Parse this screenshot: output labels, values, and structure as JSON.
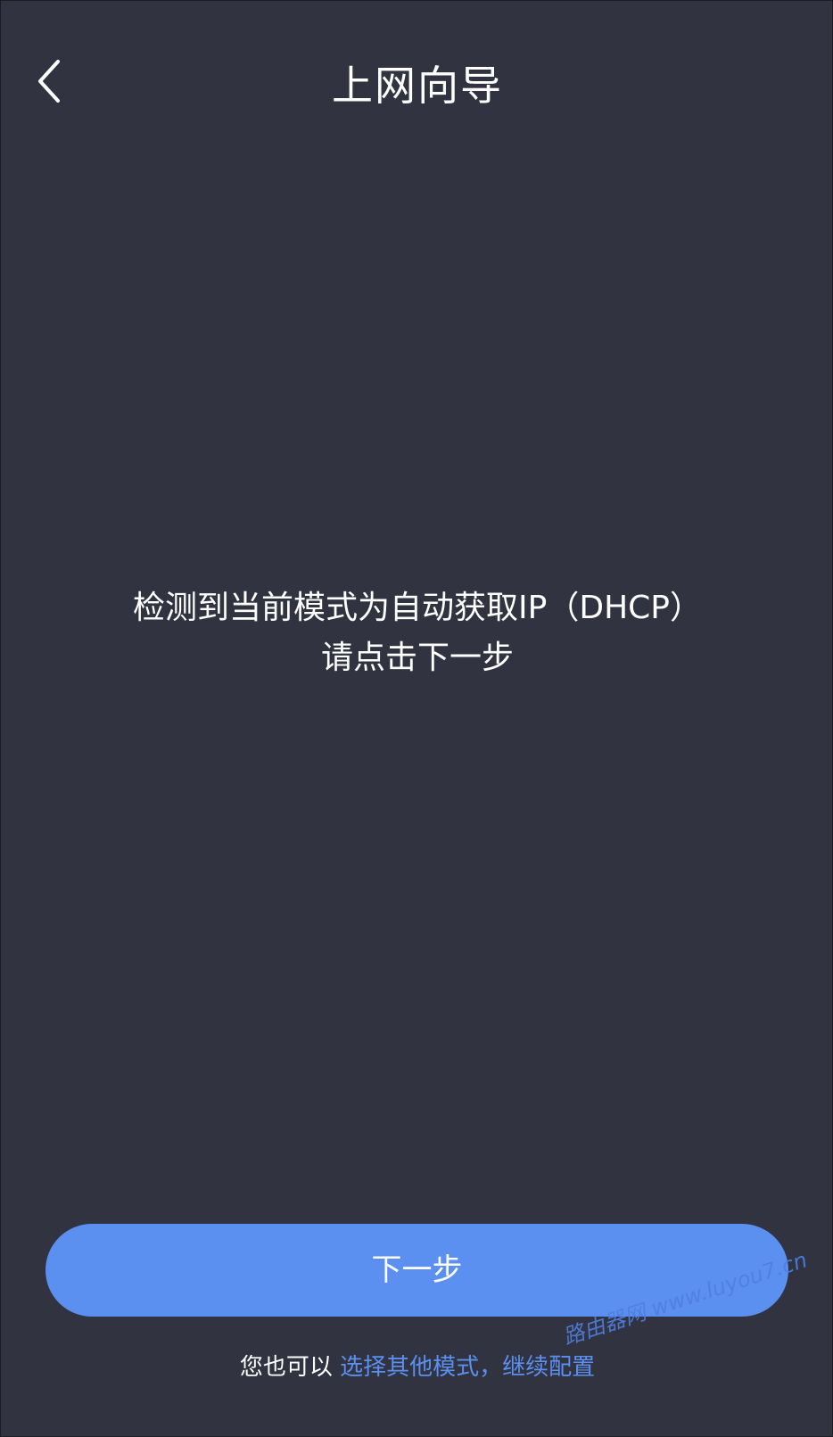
{
  "header": {
    "back_icon": "chevron-left-icon",
    "title": "上网向导"
  },
  "message": {
    "line1": "检测到当前模式为自动获取IP（DHCP）",
    "line2": "请点击下一步"
  },
  "actions": {
    "next_label": "下一步"
  },
  "footer": {
    "prefix": "您也可以 ",
    "link": "选择其他模式，继续配置"
  },
  "watermark": {
    "text": "路由器网 www.luyou7.cn"
  },
  "colors": {
    "background": "#313340",
    "accent": "#5b8ff0",
    "text": "#ffffff"
  }
}
